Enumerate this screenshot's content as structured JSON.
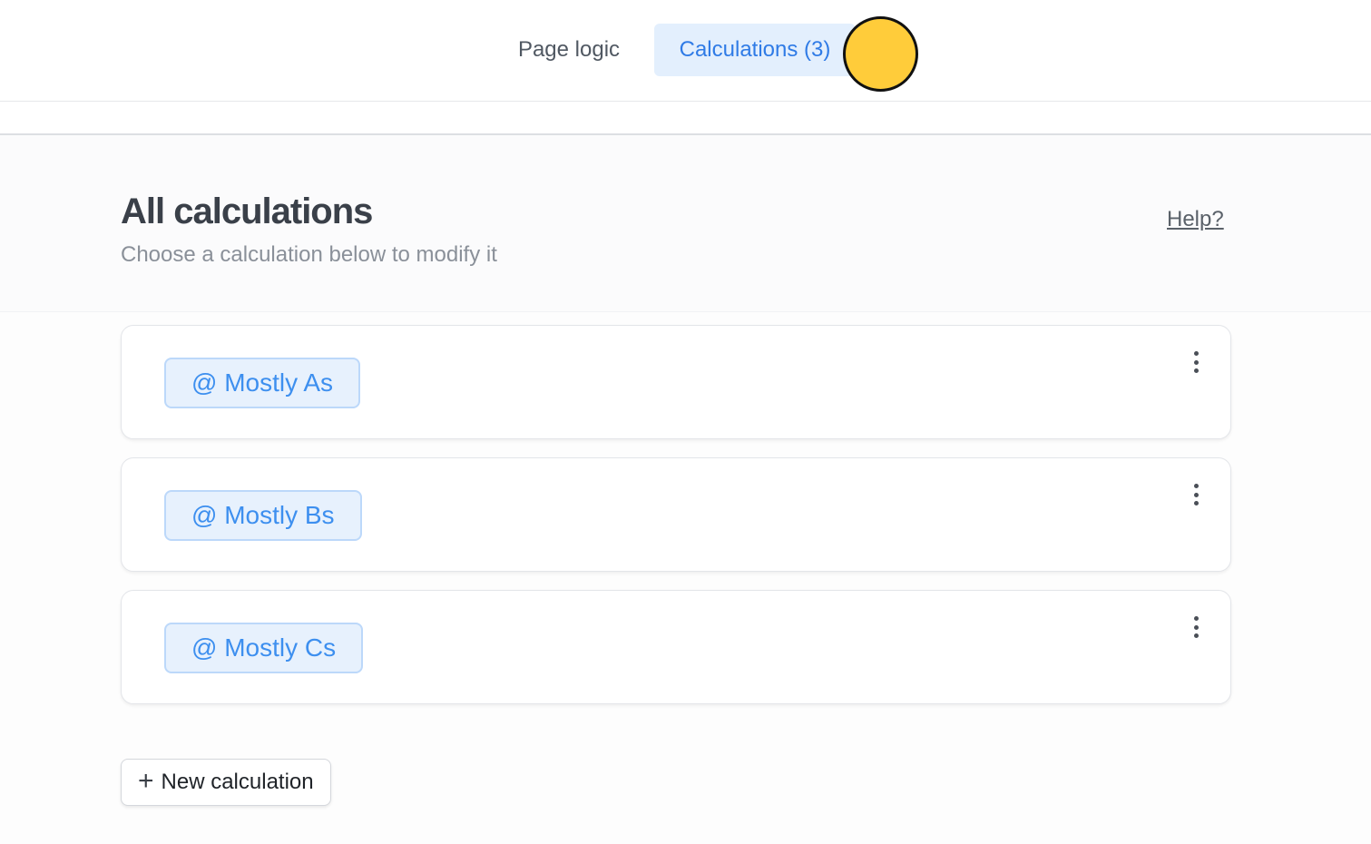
{
  "tabs": [
    {
      "label": "Page logic",
      "active": false
    },
    {
      "label": "Calculations (3)",
      "active": true
    }
  ],
  "header": {
    "title": "All calculations",
    "subtitle": "Choose a calculation below to modify it",
    "help_label": "Help?"
  },
  "calculations": [
    {
      "label": "@ Mostly As"
    },
    {
      "label": "@ Mostly Bs"
    },
    {
      "label": "@ Mostly Cs"
    }
  ],
  "new_button": {
    "icon": "plus-icon",
    "plus_glyph": "+",
    "label": "New calculation"
  },
  "colors": {
    "active_tab_bg": "#e3effd",
    "active_tab_text": "#2f7be6",
    "chip_bg": "#e7f1fd",
    "chip_border": "#bcd8fa",
    "chip_text": "#3d8fef",
    "cursor_marker": "#ffcc3a"
  }
}
